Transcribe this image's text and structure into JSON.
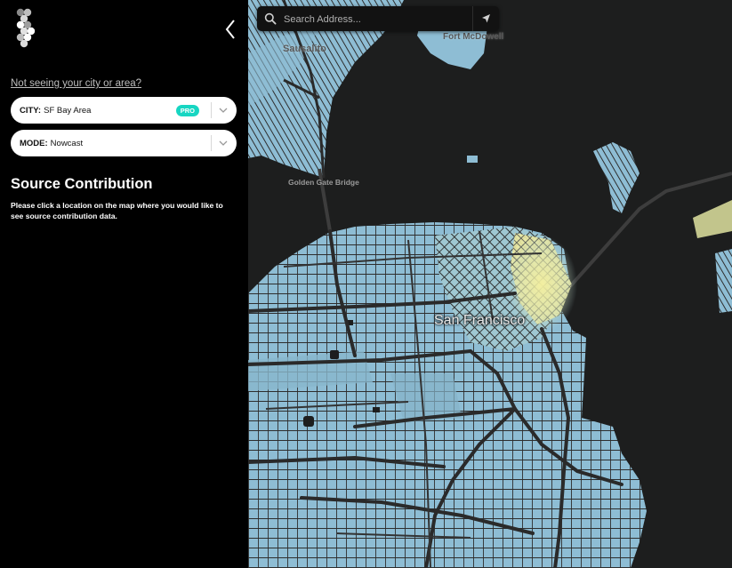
{
  "sidebar": {
    "area_link": "Not seeing your city or area?",
    "city": {
      "key": "CITY:",
      "value": "SF Bay Area",
      "badge": "PRO"
    },
    "mode": {
      "key": "MODE:",
      "value": "Nowcast"
    },
    "section_title": "Source Contribution",
    "section_desc": "Please click a location on the map where you would like to see source contribution data."
  },
  "search": {
    "placeholder": "Search Address..."
  },
  "map": {
    "labels": {
      "sausalito": "Sausalito",
      "fort_mcdowell": "Fort McDowell",
      "golden_gate_bridge": "Golden Gate Bridge",
      "city": "San Francisco"
    },
    "colors": {
      "water": "#1d1e1e",
      "land": "#8ebdd4",
      "roads": "#2e2e2e",
      "hotspot": "#f2ee9a",
      "accent": "#17d6c2"
    }
  }
}
